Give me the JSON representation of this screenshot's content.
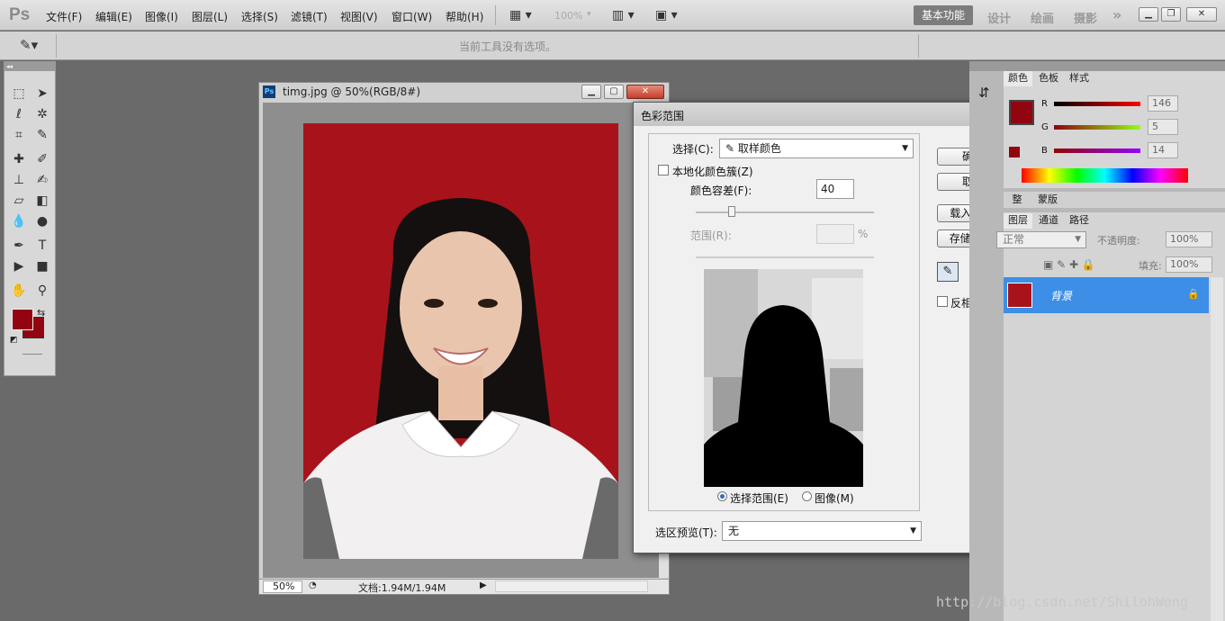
{
  "app": {
    "logo": "Ps"
  },
  "menu": [
    "文件(F)",
    "编辑(E)",
    "图像(I)",
    "图层(L)",
    "选择(S)",
    "滤镜(T)",
    "视图(V)",
    "窗口(W)",
    "帮助(H)"
  ],
  "zoom_field": "100%",
  "workspaces": {
    "active": "基本功能",
    "items": [
      "设计",
      "绘画",
      "摄影"
    ],
    "more": "»"
  },
  "options_bar": {
    "hint": "当前工具没有选项。"
  },
  "document": {
    "title": "timg.jpg @ 50%(RGB/8#)",
    "zoom": "50%",
    "doc_size": "文档:1.94M/1.94M"
  },
  "dialog": {
    "title": "色彩范围",
    "select_label": "选择(C):",
    "select_value": "取样颜色",
    "localized_label": "本地化颜色簇(Z)",
    "fuzziness_label": "颜色容差(F):",
    "fuzziness_value": "40",
    "range_label": "范围(R):",
    "range_unit": "%",
    "ok": "确定",
    "cancel": "取消",
    "load": "载入(L)...",
    "save": "存储(S)...",
    "invert": "反相(I)",
    "radio_selection": "选择范围(E)",
    "radio_image": "图像(M)",
    "preview_label": "选区预览(T):",
    "preview_value": "无",
    "close": "x"
  },
  "color_panel": {
    "tabs": [
      "颜色",
      "色板",
      "样式"
    ],
    "r_label": "R",
    "g_label": "G",
    "b_label": "B",
    "r": "146",
    "g": "5",
    "b": "14",
    "fg_color": "#920510"
  },
  "adjust_panel": {
    "tabs": [
      "整",
      "蒙版"
    ]
  },
  "layers_panel": {
    "tabs": [
      "图层",
      "通道",
      "路径"
    ],
    "blend": "正常",
    "opacity_label": "不透明度:",
    "opacity": "100%",
    "fill_label": "填充:",
    "fill": "100%",
    "layer_name": "背景"
  },
  "watermark": "http://blog.csdn.net/ShilohWong"
}
